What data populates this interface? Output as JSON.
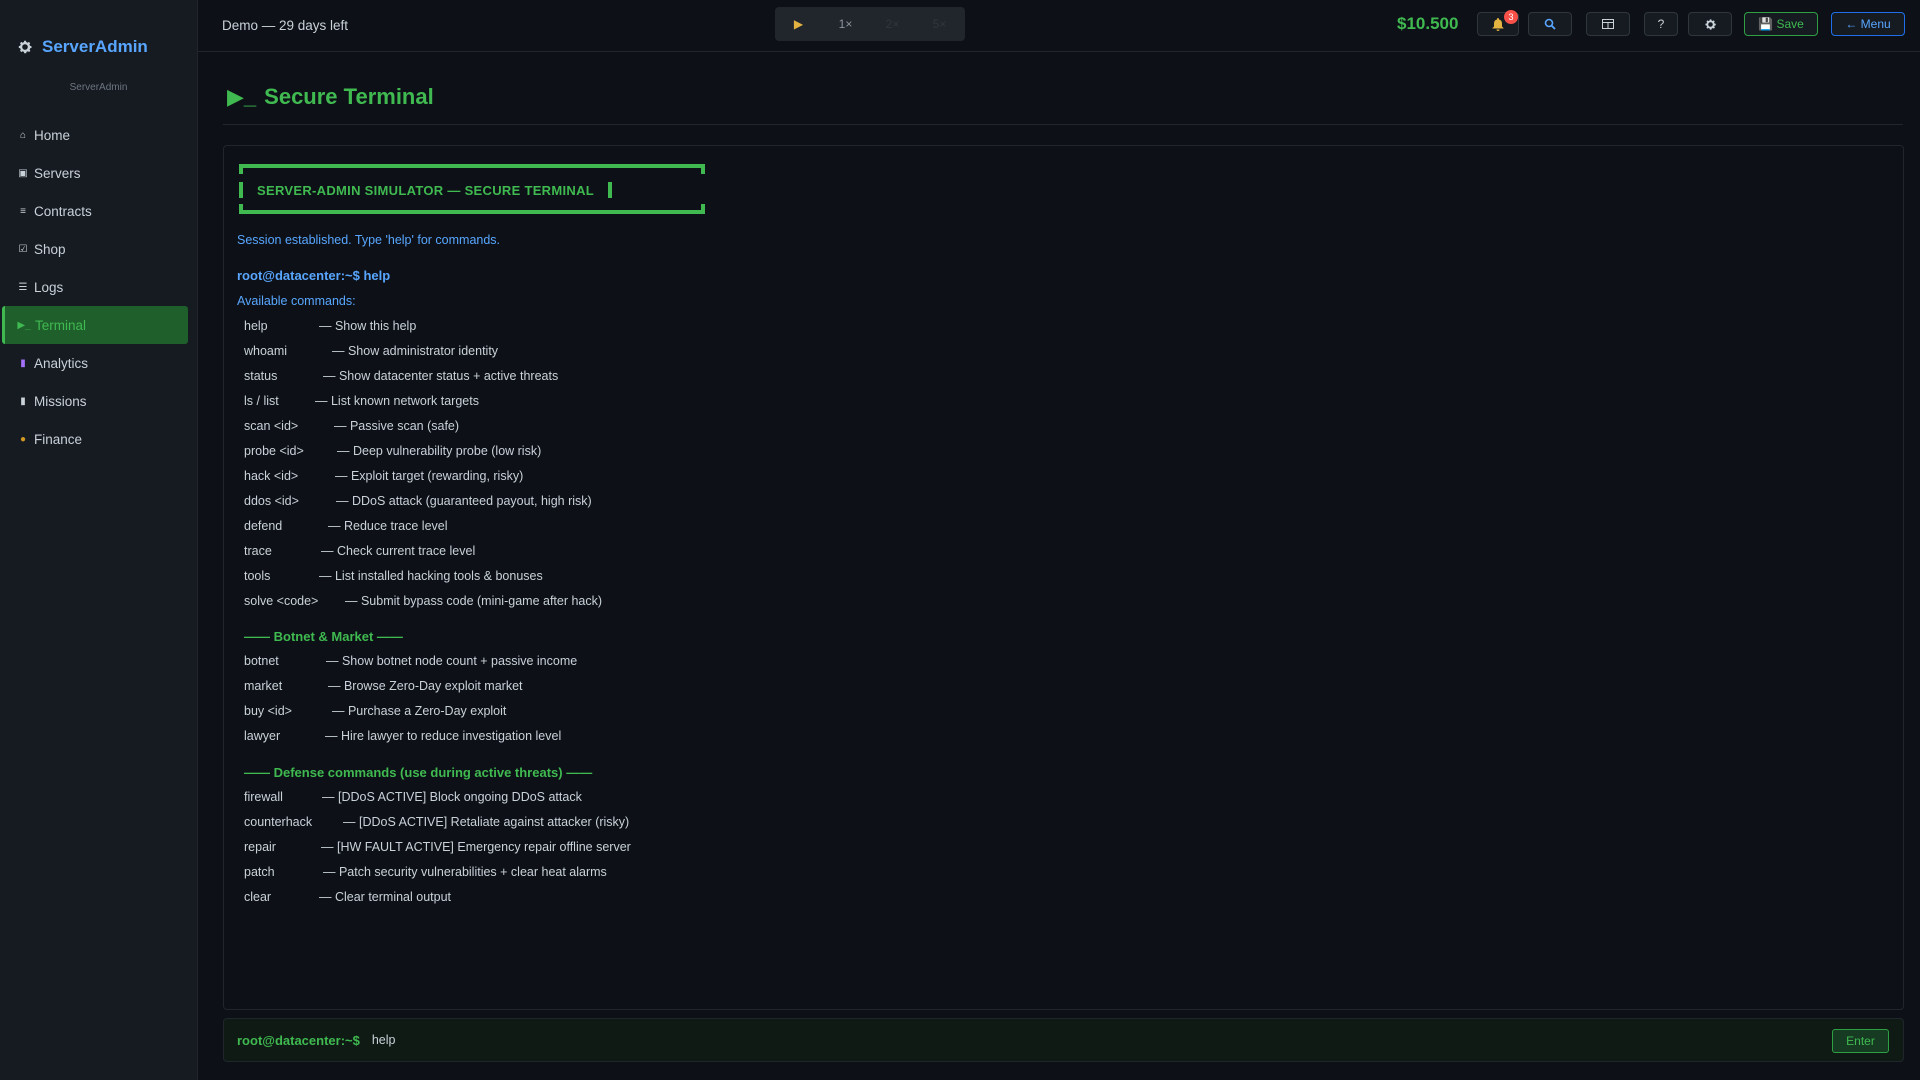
{
  "brand": {
    "name": "ServerAdmin",
    "subtitle": "ServerAdmin"
  },
  "sidebar": {
    "items": [
      {
        "icon": "⌂",
        "label": "Home"
      },
      {
        "icon": "▣",
        "label": "Servers"
      },
      {
        "icon": "≡",
        "label": "Contracts"
      },
      {
        "icon": "☑",
        "label": "Shop"
      },
      {
        "icon": "☰",
        "label": "Logs"
      },
      {
        "icon": "▶_",
        "label": "Terminal"
      },
      {
        "icon": "▮",
        "label": "Analytics"
      },
      {
        "icon": "▮",
        "label": "Missions"
      },
      {
        "icon": "●",
        "label": "Finance"
      }
    ]
  },
  "topbar": {
    "demo": "Demo — 29 days left",
    "speed": {
      "play": "▶",
      "s1": "1×",
      "s2": "2×",
      "s3": "5×"
    },
    "money": "$10.500",
    "notifications": "3",
    "help": "?",
    "save": "💾 Save",
    "menu": "← Menu"
  },
  "page": {
    "title": "Secure Terminal",
    "title_icon": "▶_"
  },
  "terminal": {
    "banner": "SERVER-ADMIN SIMULATOR  —  SECURE TERMINAL",
    "session": "Session established. Type 'help' for commands.",
    "prompt_line": "root@datacenter:~$ help",
    "available": "Available commands:",
    "commands": [
      {
        "name": "help",
        "desc": "— Show this help"
      },
      {
        "name": "whoami",
        "desc": "— Show administrator identity"
      },
      {
        "name": "status",
        "desc": "— Show datacenter status + active threats"
      },
      {
        "name": "ls / list",
        "desc": "— List known network targets"
      },
      {
        "name": "scan  <id>",
        "desc": "— Passive scan (safe)"
      },
      {
        "name": "probe <id>",
        "desc": "— Deep vulnerability probe (low risk)"
      },
      {
        "name": "hack  <id>",
        "desc": "— Exploit target (rewarding, risky)"
      },
      {
        "name": "ddos  <id>",
        "desc": "— DDoS attack (guaranteed payout, high risk)"
      },
      {
        "name": "defend",
        "desc": "— Reduce trace level"
      },
      {
        "name": "trace",
        "desc": "— Check current trace level"
      },
      {
        "name": "tools",
        "desc": "— List installed hacking tools & bonuses"
      },
      {
        "name": "solve <code>",
        "desc": "— Submit bypass code (mini-game after hack)"
      }
    ],
    "section_botnet": "—— Botnet & Market ——",
    "botnet_commands": [
      {
        "name": "botnet",
        "desc": "— Show botnet node count + passive income"
      },
      {
        "name": "market",
        "desc": "— Browse Zero-Day exploit market"
      },
      {
        "name": "buy <id>",
        "desc": "— Purchase a Zero-Day exploit"
      },
      {
        "name": "lawyer",
        "desc": "— Hire lawyer to reduce investigation level"
      }
    ],
    "section_defense": "—— Defense commands (use during active threats) ——",
    "defense_commands": [
      {
        "name": "firewall",
        "desc": "— [DDoS ACTIVE] Block ongoing DDoS attack"
      },
      {
        "name": "counterhack",
        "desc": "— [DDoS ACTIVE] Retaliate against attacker (risky)"
      },
      {
        "name": "repair",
        "desc": "— [HW FAULT ACTIVE] Emergency repair offline server"
      },
      {
        "name": "patch",
        "desc": "— Patch security vulnerabilities + clear heat alarms"
      },
      {
        "name": "clear",
        "desc": "— Clear terminal output"
      }
    ]
  },
  "input": {
    "prompt": "root@datacenter:~$",
    "value": "help",
    "enter": "Enter"
  }
}
